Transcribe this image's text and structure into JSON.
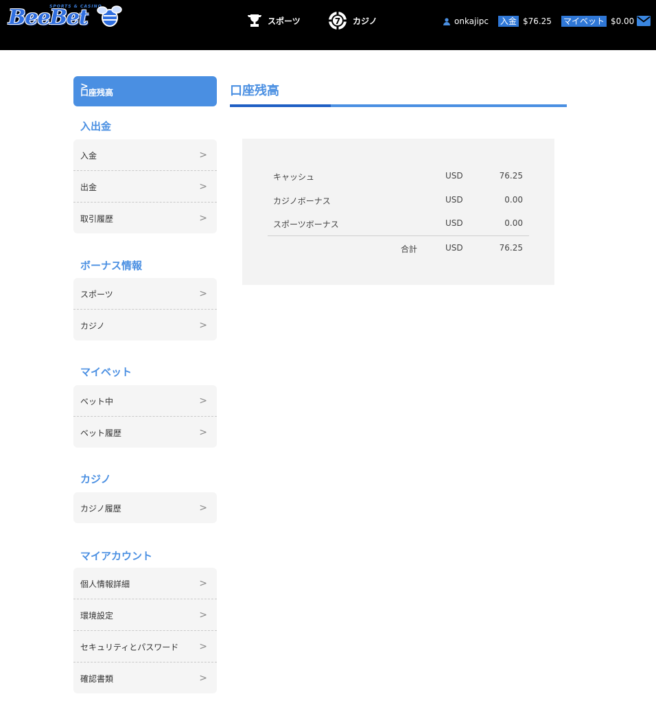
{
  "header": {
    "logo_text": "BeeBet",
    "logo_sub": "SPORTS & CASINO",
    "nav": {
      "sports": "スポーツ",
      "casino": "カジノ"
    },
    "user": {
      "username": "onkajipc",
      "deposit_label": "入金",
      "deposit_amount": "$76.25",
      "mybet_label": "マイベット",
      "mybet_amount": "$0.00"
    }
  },
  "sidebar": {
    "active": "口座残高",
    "sections": [
      {
        "title": "入出金",
        "items": [
          "入金",
          "出金",
          "取引履歴"
        ]
      },
      {
        "title": "ボーナス情報",
        "items": [
          "スポーツ",
          "カジノ"
        ]
      },
      {
        "title": "マイベット",
        "items": [
          "ベット中",
          "ベット履歴"
        ]
      },
      {
        "title": "カジノ",
        "items": [
          "カジノ履歴"
        ]
      },
      {
        "title": "マイアカウント",
        "items": [
          "個人情報詳細",
          "環境設定",
          "セキュリティとパスワード",
          "確認書類"
        ]
      }
    ]
  },
  "main": {
    "title": "口座残高",
    "balances": [
      {
        "name": "キャッシュ",
        "currency": "USD",
        "value": "76.25"
      },
      {
        "name": "カジノボーナス",
        "currency": "USD",
        "value": "0.00"
      },
      {
        "name": "スポーツボーナス",
        "currency": "USD",
        "value": "0.00"
      }
    ],
    "total": {
      "label": "合計",
      "currency": "USD",
      "value": "76.25"
    }
  },
  "colors": {
    "accent": "#4a8fe2",
    "accent_dark": "#1f5fc4",
    "header_bg": "#000000",
    "highlight": "#2f77d6"
  }
}
